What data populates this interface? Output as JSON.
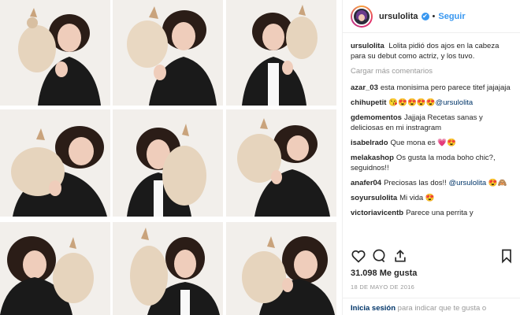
{
  "header": {
    "username": "ursulolita",
    "verified": "✔",
    "separator": "•",
    "follow_label": "Seguir"
  },
  "caption": {
    "user": "ursulolita",
    "text": "Lolita pidió dos ajos en la cabeza para su debut como actriz, y los tuvo."
  },
  "load_more": "Cargar más comentarios",
  "comments": [
    {
      "user": "azar_03",
      "text": "esta monisima pero parece titef jajajaja"
    },
    {
      "user": "chihupetit",
      "text": "😘😍😍😍😍",
      "mention": "@ursulolita"
    },
    {
      "user": "gdemomentos",
      "text": "Jajjaja Recetas sanas y deliciosas en mi instragram"
    },
    {
      "user": "isabelrado",
      "text": "Que mona es 💗😍"
    },
    {
      "user": "melakashop",
      "text": "Os gusta la moda boho chic?, seguidnos!!"
    },
    {
      "user": "anafer04",
      "text": "Preciosas las dos!!",
      "mention": "@ursulolita",
      "after": "😍🙈"
    },
    {
      "user": "soyursulolita",
      "text": "Mi vida 😍"
    },
    {
      "user": "victoriavicentb",
      "text": "Parece una perrita y"
    }
  ],
  "likes": "31.098 Me gusta",
  "date": "18 DE MAYO DE 2016",
  "login": {
    "link": "Inicia sesión",
    "text": "para indicar que te gusta o"
  },
  "colors": {
    "accent": "#3897f0",
    "background": "#f2efeb",
    "jacket": "#1a1a1a",
    "hair": "#2b1d17",
    "dog": "#e6d4bd"
  }
}
